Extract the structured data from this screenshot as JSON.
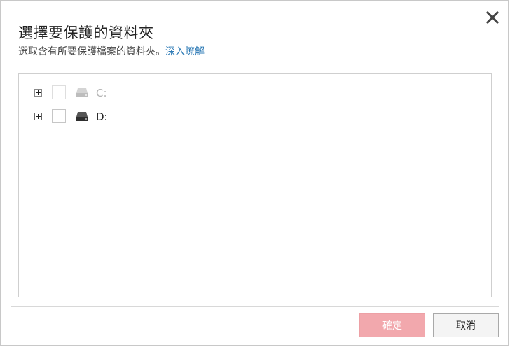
{
  "dialog": {
    "title": "選擇要保護的資料夾",
    "subtitle": "選取含有所要保護檔案的資料夾。",
    "learn_more_link": "深入瞭解",
    "close_icon": "close-icon"
  },
  "tree": {
    "items": [
      {
        "label": "C:",
        "icon": "hard-drive-icon",
        "state": "disabled",
        "checked": false,
        "expanded": false
      },
      {
        "label": "D:",
        "icon": "hard-drive-icon",
        "state": "enabled",
        "checked": false,
        "expanded": false
      }
    ]
  },
  "footer": {
    "ok_label": "確定",
    "cancel_label": "取消"
  },
  "colors": {
    "link": "#2b79b5",
    "ok_button_bg": "#f2a8ad",
    "disabled_text": "#b5b5b5"
  }
}
